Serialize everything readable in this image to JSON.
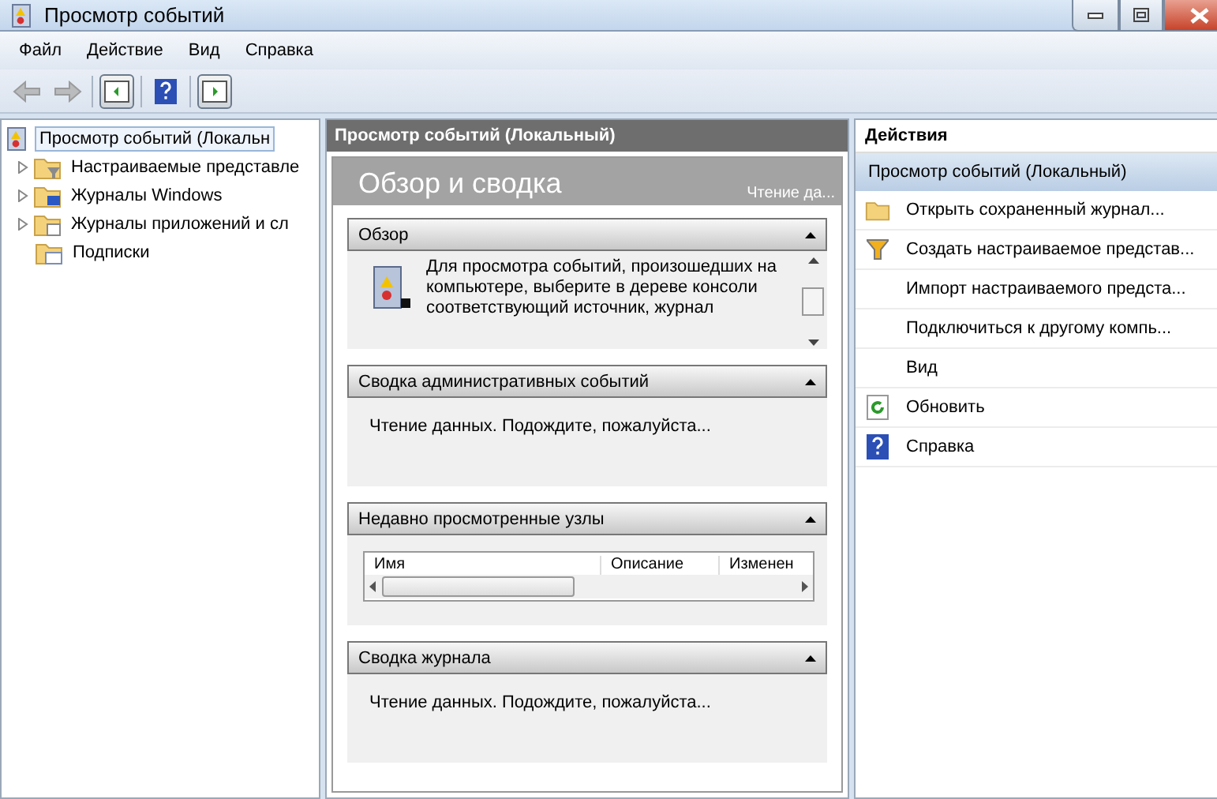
{
  "window": {
    "title": "Просмотр событий"
  },
  "menu": [
    "Файл",
    "Действие",
    "Вид",
    "Справка"
  ],
  "toolbar": [
    {
      "kind": "back",
      "disabled": true
    },
    {
      "kind": "forward",
      "disabled": true
    },
    {
      "kind": "pane-left",
      "selected": true
    },
    {
      "kind": "help",
      "selected": false
    },
    {
      "kind": "pane-right",
      "selected": true
    }
  ],
  "tree": {
    "label": "Просмотр событий (Локальн",
    "selected": true,
    "children": [
      {
        "label": "Настраиваемые представле",
        "kind": "filter",
        "expanded": false
      },
      {
        "label": "Журналы Windows",
        "kind": "windows",
        "expanded": false
      },
      {
        "label": "Журналы приложений и сл",
        "kind": "apps",
        "expanded": false
      },
      {
        "label": "Подписки",
        "kind": "subs"
      }
    ]
  },
  "center": {
    "header": "Просмотр событий (Локальный)",
    "title": "Обзор и сводка",
    "status": "Чтение да...",
    "sections": [
      {
        "kind": "text-icon",
        "title": "Обзор",
        "expanded": true,
        "text": "Для просмотра событий, произошедших на компьютере, выберите в дереве консоли соответствующий источник, журнал"
      },
      {
        "kind": "text",
        "title": "Сводка административных событий",
        "expanded": true,
        "text": "Чтение данных. Подождите, пожалуйста..."
      },
      {
        "kind": "table",
        "title": "Недавно просмотренные узлы",
        "expanded": true,
        "columns": [
          "Имя",
          "Описание",
          "Изменен"
        ]
      },
      {
        "kind": "text",
        "title": "Сводка журнала",
        "expanded": true,
        "text": "Чтение данных. Подождите, пожалуйста..."
      }
    ]
  },
  "actions": {
    "title": "Действия",
    "group": {
      "label": "Просмотр событий (Локальный)",
      "selected": true
    },
    "items": [
      {
        "kind": "folder",
        "label": "Открыть сохраненный журнал..."
      },
      {
        "kind": "filter",
        "label": "Создать настраиваемое представ..."
      },
      {
        "kind": "plain",
        "label": "Импорт настраиваемого предста..."
      },
      {
        "kind": "plain",
        "label": "Подключиться к другому компь..."
      },
      {
        "kind": "plain",
        "label": "Вид"
      },
      {
        "kind": "refresh",
        "label": "Обновить"
      },
      {
        "kind": "help",
        "label": "Справка"
      }
    ]
  }
}
